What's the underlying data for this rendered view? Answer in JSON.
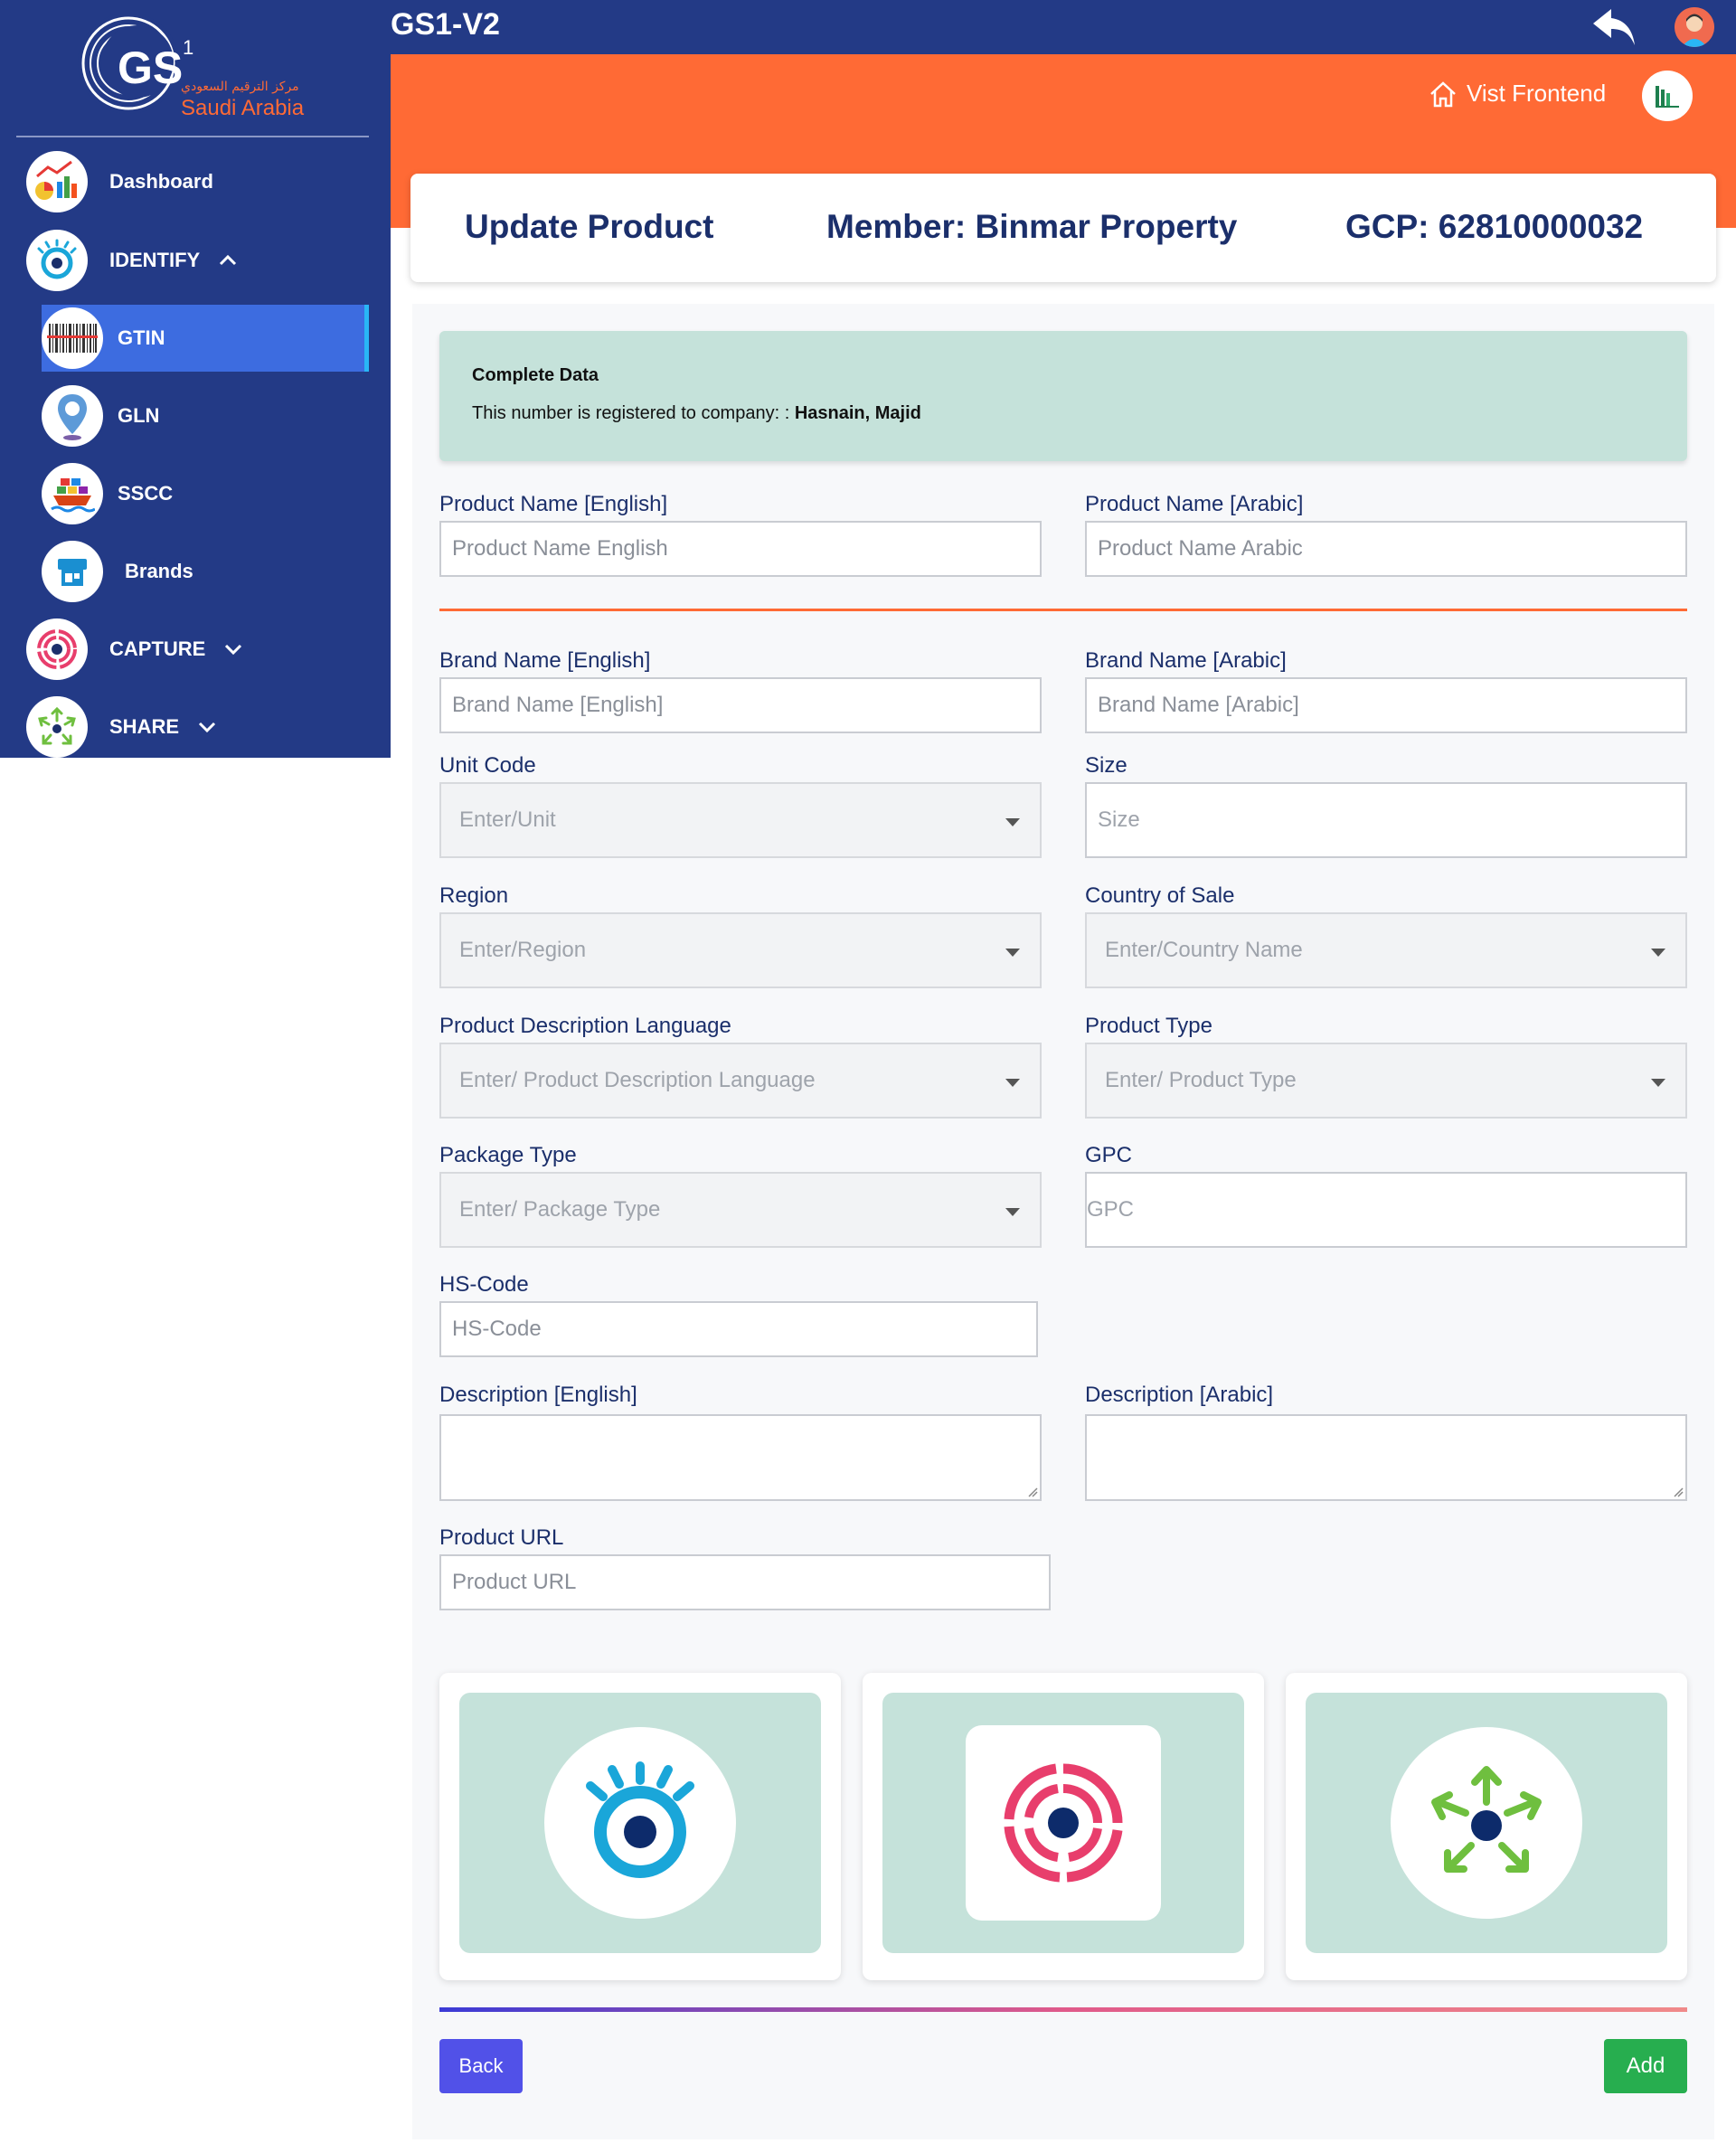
{
  "app": {
    "title": "GS1-V2"
  },
  "logo": {
    "brand": "GS",
    "superscript": "1",
    "arabic": "مركز الترقيم السعودي",
    "region": "Saudi Arabia"
  },
  "sidebar": {
    "items": [
      {
        "label": "Dashboard",
        "icon": "dashboard-chart-icon"
      },
      {
        "label": "IDENTIFY",
        "icon": "identify-eye-icon",
        "expanded": true
      },
      {
        "label": "GTIN",
        "icon": "barcode-icon",
        "active": true
      },
      {
        "label": "GLN",
        "icon": "location-pin-icon"
      },
      {
        "label": "SSCC",
        "icon": "shipping-container-icon"
      },
      {
        "label": "Brands",
        "icon": "brand-tag-icon"
      },
      {
        "label": "CAPTURE",
        "icon": "capture-target-icon",
        "expanded": false
      },
      {
        "label": "SHARE",
        "icon": "share-arrows-icon",
        "expanded": false
      }
    ]
  },
  "header": {
    "visit_frontend": "Vist Frontend",
    "page_title": "Update Product",
    "member": "Member: Binmar Property",
    "gcp": "GCP: 62810000032"
  },
  "info": {
    "title": "Complete Data",
    "text": "This number is registered to company: :",
    "company": "Hasnain, Majid"
  },
  "form": {
    "product_name_en": {
      "label": "Product Name [English]",
      "placeholder": "Product Name English"
    },
    "product_name_ar": {
      "label": "Product Name [Arabic]",
      "placeholder": "Product Name Arabic"
    },
    "brand_name_en": {
      "label": "Brand Name [English]",
      "placeholder": "Brand Name [English]"
    },
    "brand_name_ar": {
      "label": "Brand Name [Arabic]",
      "placeholder": "Brand Name [Arabic]"
    },
    "unit_code": {
      "label": "Unit Code",
      "placeholder": "Enter/Unit"
    },
    "size": {
      "label": "Size",
      "placeholder": "Size"
    },
    "region": {
      "label": "Region",
      "placeholder": "Enter/Region"
    },
    "country_of_sale": {
      "label": "Country of Sale",
      "placeholder": "Enter/Country Name"
    },
    "product_desc_lang": {
      "label": "Product Description Language",
      "placeholder": "Enter/ Product Description Language"
    },
    "product_type": {
      "label": "Product Type",
      "placeholder": "Enter/ Product Type"
    },
    "package_type": {
      "label": "Package Type",
      "placeholder": "Enter/ Package Type"
    },
    "gpc": {
      "label": "GPC",
      "placeholder": "GPC"
    },
    "hs_code": {
      "label": "HS-Code",
      "placeholder": "HS-Code"
    },
    "description_en": {
      "label": "Description [English]",
      "value": ""
    },
    "description_ar": {
      "label": "Description [Arabic]",
      "value": ""
    },
    "product_url": {
      "label": "Product URL",
      "placeholder": "Product URL"
    }
  },
  "cards": [
    {
      "icon": "identify-eye-icon"
    },
    {
      "icon": "capture-target-icon"
    },
    {
      "icon": "share-arrows-icon"
    }
  ],
  "buttons": {
    "back": "Back",
    "add": "Add"
  },
  "colors": {
    "sidebar": "#233a86",
    "orange": "#ff6a35",
    "active_nav": "#3d6ce0",
    "info_bg": "#c5e2da",
    "back_btn": "#5151e8",
    "add_btn": "#27ae4f",
    "heading": "#1b2f6b"
  }
}
